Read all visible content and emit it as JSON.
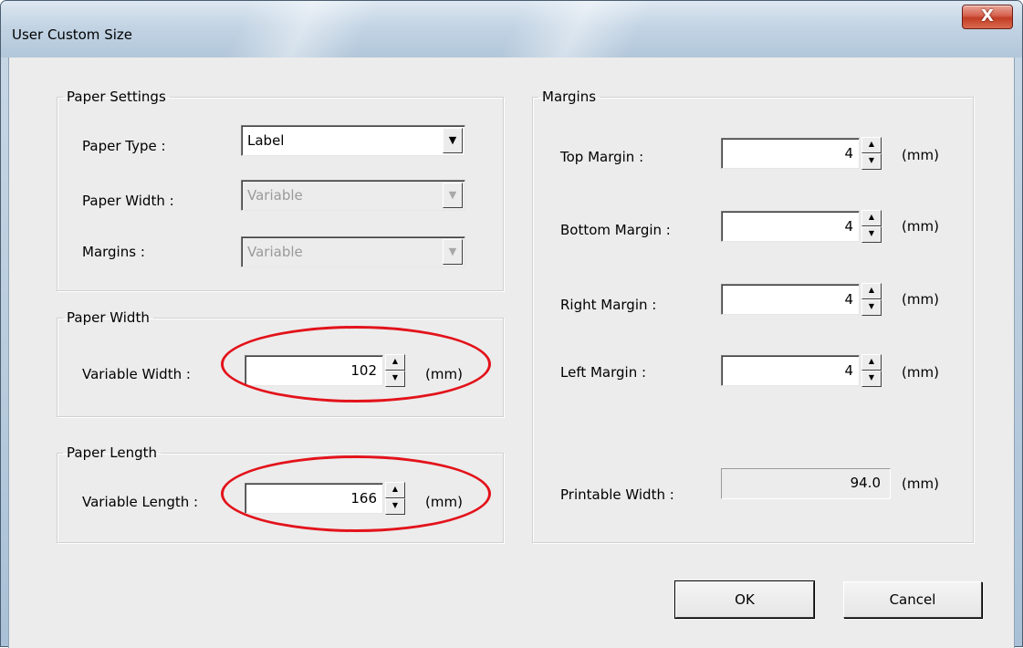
{
  "window": {
    "title": "User Custom Size",
    "close_label": "X"
  },
  "paper_settings": {
    "legend": "Paper Settings",
    "paper_type_label": "Paper Type :",
    "paper_type_value": "Label",
    "paper_width_label": "Paper Width :",
    "paper_width_value": "Variable",
    "margins_label": "Margins :",
    "margins_value": "Variable"
  },
  "paper_width": {
    "legend": "Paper Width",
    "label": "Variable Width :",
    "value": "102",
    "unit": "(mm)"
  },
  "paper_length": {
    "legend": "Paper Length",
    "label": "Variable Length :",
    "value": "166",
    "unit": "(mm)"
  },
  "margins": {
    "legend": "Margins",
    "top_label": "Top Margin :",
    "top_value": "4",
    "bottom_label": "Bottom Margin :",
    "bottom_value": "4",
    "right_label": "Right Margin :",
    "right_value": "4",
    "left_label": "Left Margin :",
    "left_value": "4",
    "printable_label": "Printable Width :",
    "printable_value": "94.0",
    "unit": "(mm)"
  },
  "buttons": {
    "ok": "OK",
    "cancel": "Cancel"
  },
  "colors": {
    "highlight": "#e3131b"
  }
}
